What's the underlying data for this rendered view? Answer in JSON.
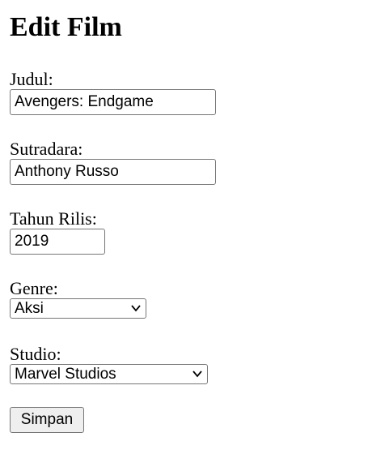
{
  "page_title": "Edit Film",
  "form": {
    "judul": {
      "label": "Judul:",
      "value": "Avengers: Endgame"
    },
    "sutradara": {
      "label": "Sutradara:",
      "value": "Anthony Russo"
    },
    "tahun": {
      "label": "Tahun Rilis:",
      "value": "2019"
    },
    "genre": {
      "label": "Genre:",
      "selected": "Aksi"
    },
    "studio": {
      "label": "Studio:",
      "selected": "Marvel Studios"
    },
    "submit_label": "Simpan"
  },
  "icons": {
    "select_arrow": "chevron-down-icon"
  }
}
